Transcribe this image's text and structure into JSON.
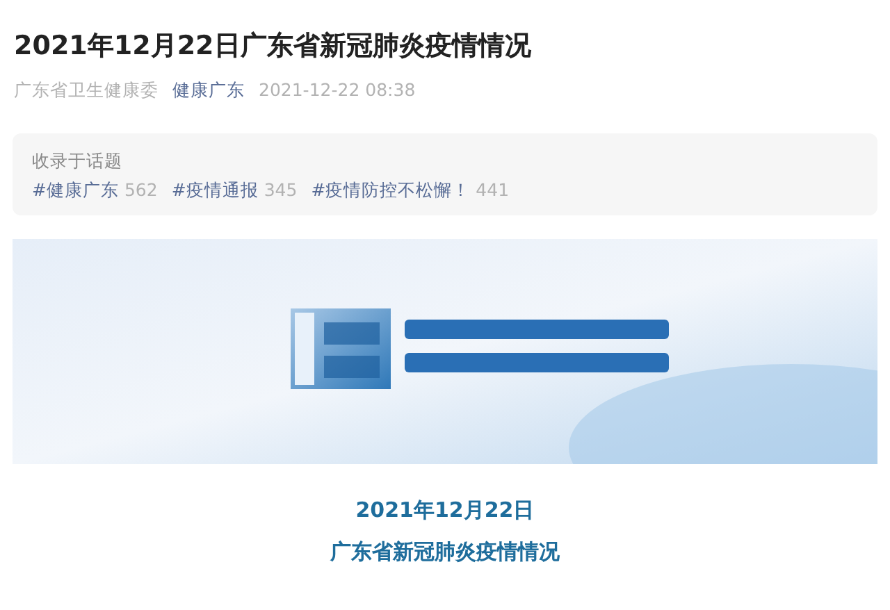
{
  "article": {
    "title": "2021年12月22日广东省新冠肺炎疫情情况",
    "author": "广东省卫生健康委",
    "account": "健康广东",
    "date": "2021-12-22 08:38"
  },
  "topics": {
    "heading": "收录于话题",
    "items": [
      {
        "name": "#健康广东",
        "count": "562"
      },
      {
        "name": "#疫情通报",
        "count": "345"
      },
      {
        "name": "#疫情防控不松懈！",
        "count": "441"
      }
    ]
  },
  "banner": {
    "kind": "picture"
  },
  "body_heading": [
    "2021年12月22日",
    "广东省新冠肺炎疫情情况"
  ]
}
